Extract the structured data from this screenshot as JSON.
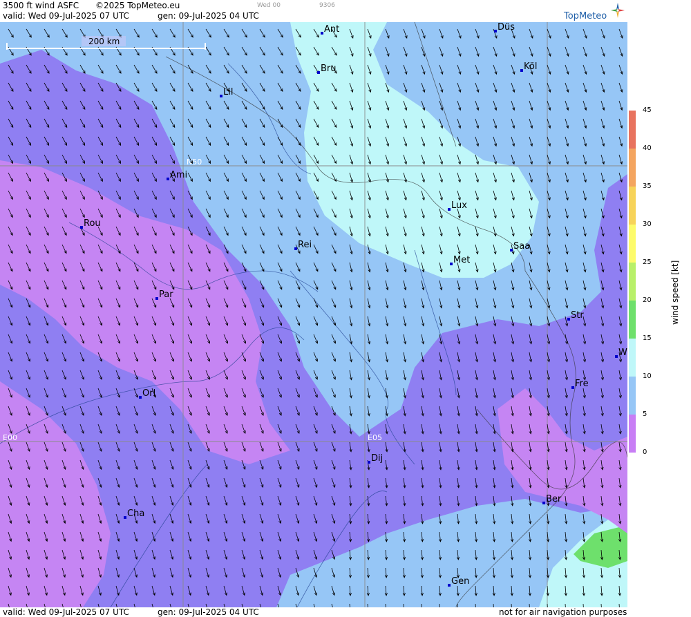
{
  "header": {
    "title": "3500 ft wind ASFC",
    "copyright": "©2025 TopMeteo.eu",
    "valid": "valid:  Wed  09-Jul-2025  07 UTC",
    "gen": "gen: 09-Jul-2025 04 UTC",
    "extra1": "Wed 00",
    "extra2": "9306",
    "brand": "TopMeteo"
  },
  "footer": {
    "valid": "valid:  Wed  09-Jul-2025  07 UTC",
    "gen": "gen: 09-Jul-2025 04 UTC",
    "note": "not for air navigation purposes"
  },
  "scale_bar": "200 km",
  "grid_labels": {
    "lat": "N50",
    "lon0": "E00",
    "lon5": "E05"
  },
  "cities": [
    {
      "name": "Ant"
    },
    {
      "name": "Düs"
    },
    {
      "name": "Bru"
    },
    {
      "name": "Köl"
    },
    {
      "name": "Lil"
    },
    {
      "name": "Ami"
    },
    {
      "name": "Rou"
    },
    {
      "name": "Lux"
    },
    {
      "name": "Rei"
    },
    {
      "name": "Saa"
    },
    {
      "name": "Met"
    },
    {
      "name": "Par"
    },
    {
      "name": "Str"
    },
    {
      "name": "W"
    },
    {
      "name": "Fre"
    },
    {
      "name": "Orl"
    },
    {
      "name": "Dij"
    },
    {
      "name": "Ber"
    },
    {
      "name": "Cha"
    },
    {
      "name": "Gen"
    }
  ],
  "legend": {
    "title": "wind speed [kt]",
    "ticks": [
      "45",
      "40",
      "35",
      "30",
      "25",
      "20",
      "15",
      "10",
      "5",
      "0"
    ],
    "colors": [
      "#e8735f",
      "#f4a560",
      "#f7d35a",
      "#fdfb6b",
      "#b8f06a",
      "#6ee06c",
      "#bff7f9",
      "#96c6f6",
      "#8f7ff2",
      "#c87ef5"
    ]
  },
  "map_colors": {
    "calm": "#c585f3",
    "light": "#8f7ff2",
    "moderate": "#96c6f6",
    "fresh": "#bff7f9",
    "strong": "#6ee06c"
  }
}
